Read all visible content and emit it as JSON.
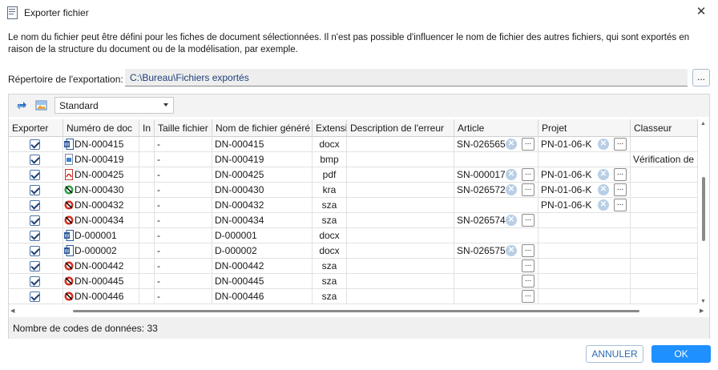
{
  "window": {
    "title": "Exporter fichier",
    "close_glyph": "✕"
  },
  "description": "Le nom du fichier peut être défini pour les fiches de document sélectionnées. Il n'est pas possible d'influencer le nom de fichier des autres fichiers, qui sont exportés en raison de la structure du document ou de la modélisation, par exemple.",
  "export_dir": {
    "label": "Répertoire de l'exportation:",
    "value": "C:\\Bureau\\Fichiers exportés",
    "browse_label": "..."
  },
  "toolbar": {
    "icons": [
      "refresh-icon",
      "image-settings-icon"
    ],
    "view_select": "Standard"
  },
  "columns": [
    "Exporter",
    "Numéro de doc",
    "In",
    "Taille fichier",
    "Nom de fichier généré",
    "Extension",
    "Description de l'erreur",
    "Article",
    "Projet",
    "Classeur"
  ],
  "rows": [
    {
      "doc_no": "DN-000415",
      "icon": "word",
      "size": "-",
      "filename": "DN-000415",
      "ext": "docx",
      "article": "SN-026565",
      "project": "PN-01-06-K",
      "classeur": "",
      "art_dots": true,
      "proj_dots": true
    },
    {
      "doc_no": "DN-000419",
      "icon": "bmp",
      "size": "-",
      "filename": "DN-000419",
      "ext": "bmp",
      "article": "",
      "project": "",
      "classeur": "Vérification de c",
      "art_dots": false,
      "proj_dots": false
    },
    {
      "doc_no": "DN-000425",
      "icon": "pdf",
      "size": "-",
      "filename": "DN-000425",
      "ext": "pdf",
      "article": "SN-000017",
      "project": "PN-01-06-K",
      "classeur": "",
      "art_dots": true,
      "proj_dots": true
    },
    {
      "doc_no": "DN-000430",
      "icon": "kra",
      "size": "-",
      "filename": "DN-000430",
      "ext": "kra",
      "article": "SN-026572",
      "project": "PN-01-06-K",
      "classeur": "",
      "art_dots": true,
      "proj_dots": true
    },
    {
      "doc_no": "DN-000432",
      "icon": "sza",
      "size": "-",
      "filename": "DN-000432",
      "ext": "sza",
      "article": "",
      "project": "PN-01-06-K",
      "classeur": "",
      "art_dots": false,
      "proj_dots": true
    },
    {
      "doc_no": "DN-000434",
      "icon": "sza",
      "size": "-",
      "filename": "DN-000434",
      "ext": "sza",
      "article": "SN-026574",
      "project": "",
      "classeur": "",
      "art_dots": true,
      "proj_dots": false
    },
    {
      "doc_no": "D-000001",
      "icon": "word",
      "size": "-",
      "filename": "D-000001",
      "ext": "docx",
      "article": "",
      "project": "",
      "classeur": "",
      "art_dots": false,
      "proj_dots": false
    },
    {
      "doc_no": "D-000002",
      "icon": "word",
      "size": "-",
      "filename": "D-000002",
      "ext": "docx",
      "article": "SN-026575",
      "project": "",
      "classeur": "",
      "art_dots": true,
      "proj_dots": false
    },
    {
      "doc_no": "DN-000442",
      "icon": "sza",
      "size": "-",
      "filename": "DN-000442",
      "ext": "sza",
      "article": "",
      "project": "",
      "classeur": "",
      "art_dots": true,
      "proj_dots": false
    },
    {
      "doc_no": "DN-000445",
      "icon": "sza",
      "size": "-",
      "filename": "DN-000445",
      "ext": "sza",
      "article": "",
      "project": "",
      "classeur": "",
      "art_dots": true,
      "proj_dots": false
    },
    {
      "doc_no": "DN-000446",
      "icon": "sza",
      "size": "-",
      "filename": "DN-000446",
      "ext": "sza",
      "article": "",
      "project": "",
      "classeur": "",
      "art_dots": true,
      "proj_dots": false
    }
  ],
  "status": "Nombre de codes de données: 33",
  "buttons": {
    "cancel": "ANNULER",
    "ok": "OK"
  }
}
